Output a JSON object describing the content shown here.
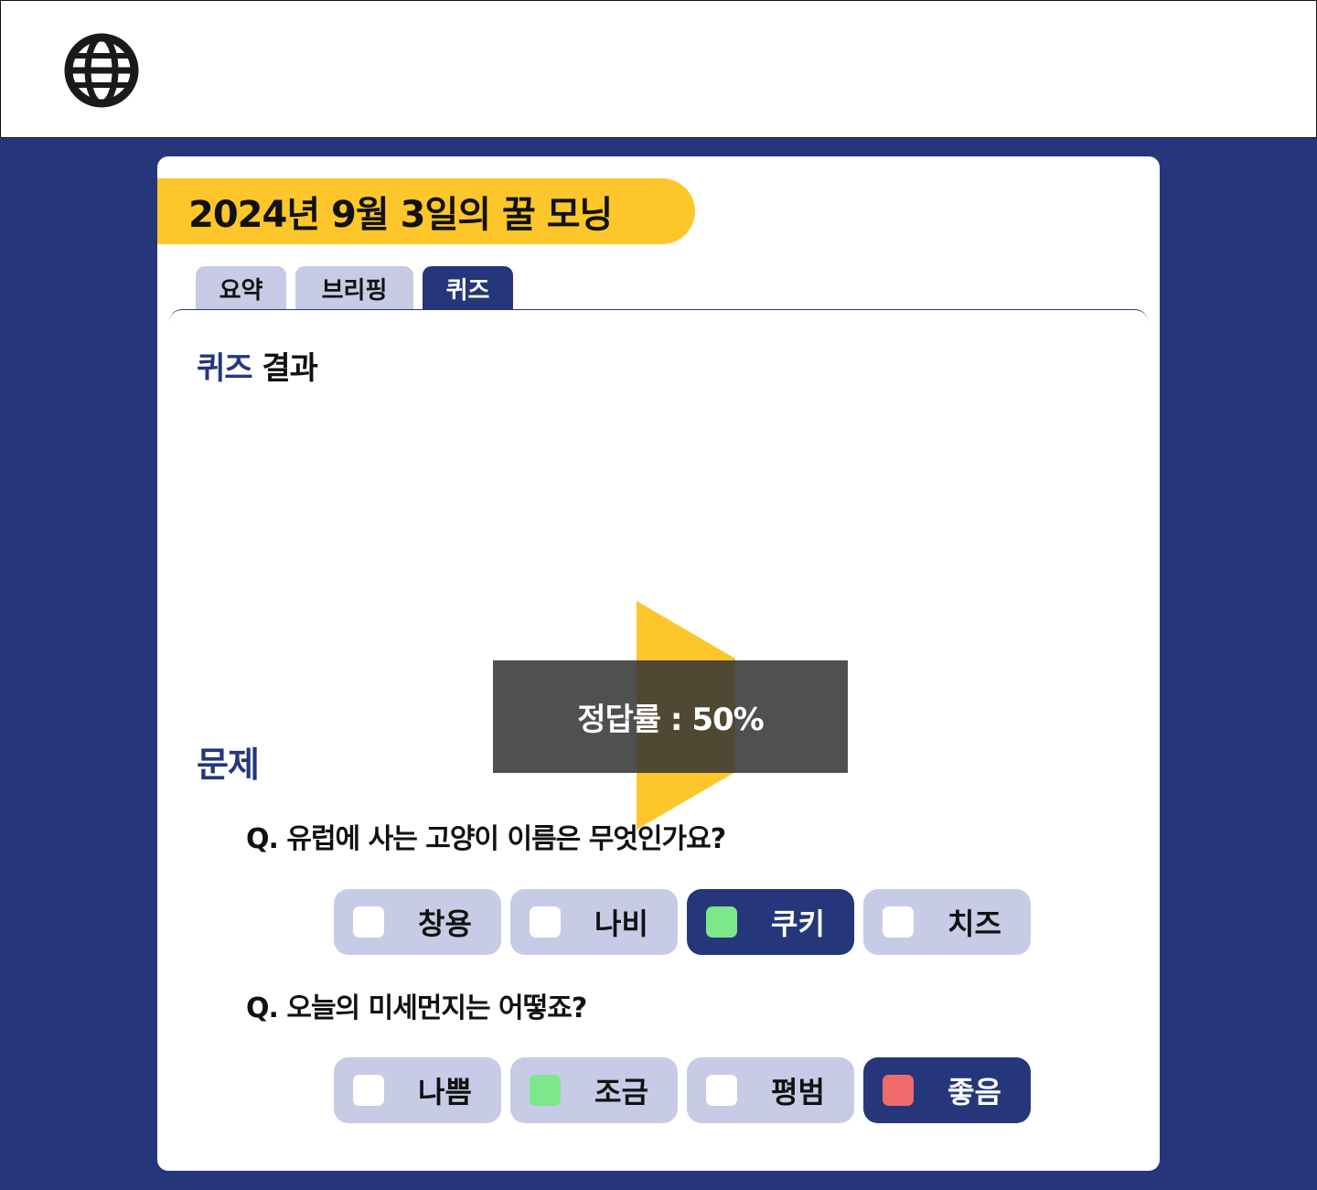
{
  "header": {
    "icon": "globe-icon"
  },
  "card": {
    "title": "2024년 9월 3일의 꿀 모닝",
    "tabs": [
      {
        "label": "요약",
        "active": false
      },
      {
        "label": "브리핑",
        "active": false
      },
      {
        "label": "퀴즈",
        "active": true
      }
    ]
  },
  "result": {
    "title_accent": "퀴즈",
    "title_rest": " 결과",
    "score_text": "정답률 : 50%",
    "score_percent": 50
  },
  "questions_section": {
    "title": "문제",
    "questions": [
      {
        "text": "Q. 유럽에 사는 고양이 이름은 무엇인가요?",
        "options": [
          {
            "label": "창용",
            "selected": false,
            "marker_color": "#ffffff"
          },
          {
            "label": "나비",
            "selected": false,
            "marker_color": "#ffffff"
          },
          {
            "label": "쿠키",
            "selected": true,
            "marker_color": "#7de88a"
          },
          {
            "label": "치즈",
            "selected": false,
            "marker_color": "#ffffff"
          }
        ]
      },
      {
        "text": "Q. 오늘의 미세먼지는 어떻죠?",
        "options": [
          {
            "label": "나쁨",
            "selected": false,
            "marker_color": "#ffffff"
          },
          {
            "label": "조금",
            "selected": false,
            "marker_color": "#7de88a"
          },
          {
            "label": "평범",
            "selected": false,
            "marker_color": "#ffffff"
          },
          {
            "label": "좋음",
            "selected": true,
            "marker_color": "#ef6b6b"
          }
        ]
      }
    ]
  },
  "colors": {
    "navy": "#25377a",
    "yellow": "#fdc62a",
    "lavender": "#c8cbe6",
    "correct": "#7de88a",
    "wrong": "#ef6b6b"
  }
}
